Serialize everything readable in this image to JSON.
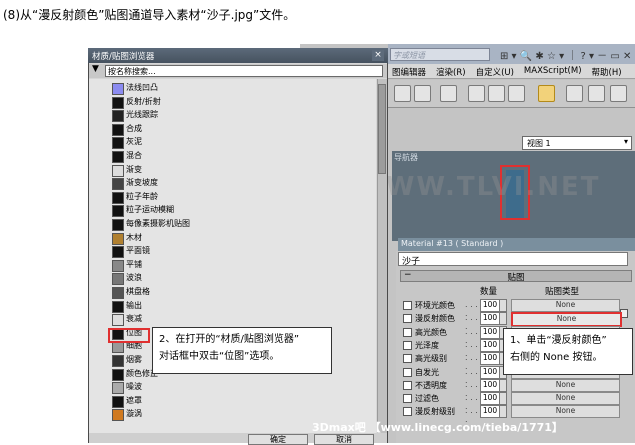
{
  "instruction": "(8)从“漫反射颜色”贴图通道导入素材“沙子.jpg”文件。",
  "max": {
    "search_placeholder": "字或短语",
    "menus": [
      "图编辑器",
      "渲染(R)",
      "自定义(U)",
      "MAXScript(M)",
      "帮助(H)"
    ],
    "view_select": "视图 1",
    "navigator_title": "导航器",
    "material_title": "Material #13  ( Standard )",
    "material_name": "沙子",
    "rollout_title": "贴图",
    "col_amount": "数量",
    "col_maptype": "贴图类型",
    "maps": [
      {
        "label": "环境光颜色",
        "amount": "100",
        "button": "None"
      },
      {
        "label": "漫反射颜色",
        "amount": "100",
        "button": "None"
      },
      {
        "label": "高光颜色",
        "amount": "100",
        "button": "None"
      },
      {
        "label": "光泽度",
        "amount": "100",
        "button": "None"
      },
      {
        "label": "高光级别",
        "amount": "100",
        "button": "None"
      },
      {
        "label": "自发光",
        "amount": "100",
        "button": "None"
      },
      {
        "label": "不透明度",
        "amount": "100",
        "button": "None"
      },
      {
        "label": "过滤色",
        "amount": "100",
        "button": "None"
      },
      {
        "label": "漫反射级别",
        "amount": "100",
        "button": "None"
      }
    ]
  },
  "browser": {
    "title": "材质/贴图浏览器",
    "close": "×",
    "search_placeholder": "按名称搜索...",
    "items": [
      {
        "label": "法线凹凸",
        "swatch": "#8b8bf0"
      },
      {
        "label": "反射/折射",
        "swatch": "#111111"
      },
      {
        "label": "光线跟踪",
        "swatch": "#222222"
      },
      {
        "label": "合成",
        "swatch": "#111111"
      },
      {
        "label": "灰泥",
        "swatch": "#111111"
      },
      {
        "label": "混合",
        "swatch": "#111111"
      },
      {
        "label": "渐变",
        "swatch": "#dcdcdc"
      },
      {
        "label": "渐变坡度",
        "swatch": "#444444"
      },
      {
        "label": "粒子年龄",
        "swatch": "#111111"
      },
      {
        "label": "粒子运动模糊",
        "swatch": "#111111"
      },
      {
        "label": "每像素摄影机贴图",
        "swatch": "#111111"
      },
      {
        "label": "木材",
        "swatch": "#b08030"
      },
      {
        "label": "平面镜",
        "swatch": "#111111"
      },
      {
        "label": "平铺",
        "swatch": "#888888"
      },
      {
        "label": "波浪",
        "swatch": "#777777"
      },
      {
        "label": "棋盘格",
        "swatch": "#555555"
      },
      {
        "label": "输出",
        "swatch": "#111111"
      },
      {
        "label": "衰减",
        "swatch": "#dddddd"
      },
      {
        "label": "位图",
        "swatch": "#111111"
      },
      {
        "label": "细胞",
        "swatch": "#999999"
      },
      {
        "label": "烟雾",
        "swatch": "#333333"
      },
      {
        "label": "颜色修正",
        "swatch": "#111111"
      },
      {
        "label": "噪波",
        "swatch": "#aaaaaa"
      },
      {
        "label": "遮罩",
        "swatch": "#111111"
      },
      {
        "label": "漩涡",
        "swatch": "#d07a20"
      }
    ],
    "ok": "确定",
    "cancel": "取消"
  },
  "callout_left": {
    "line1": "2、在打开的“材质/贴图浏览器”",
    "line2": "对话框中双击“位图”选项。"
  },
  "callout_right": {
    "line1": "1、单击“漫反射颜色”",
    "line2": "右侧的 None 按钮。"
  },
  "watermark": "腾龍視覺 WWW.TLVI.NET",
  "footer": "3Dmax吧 【www.linecg.com/tieba/1771】"
}
